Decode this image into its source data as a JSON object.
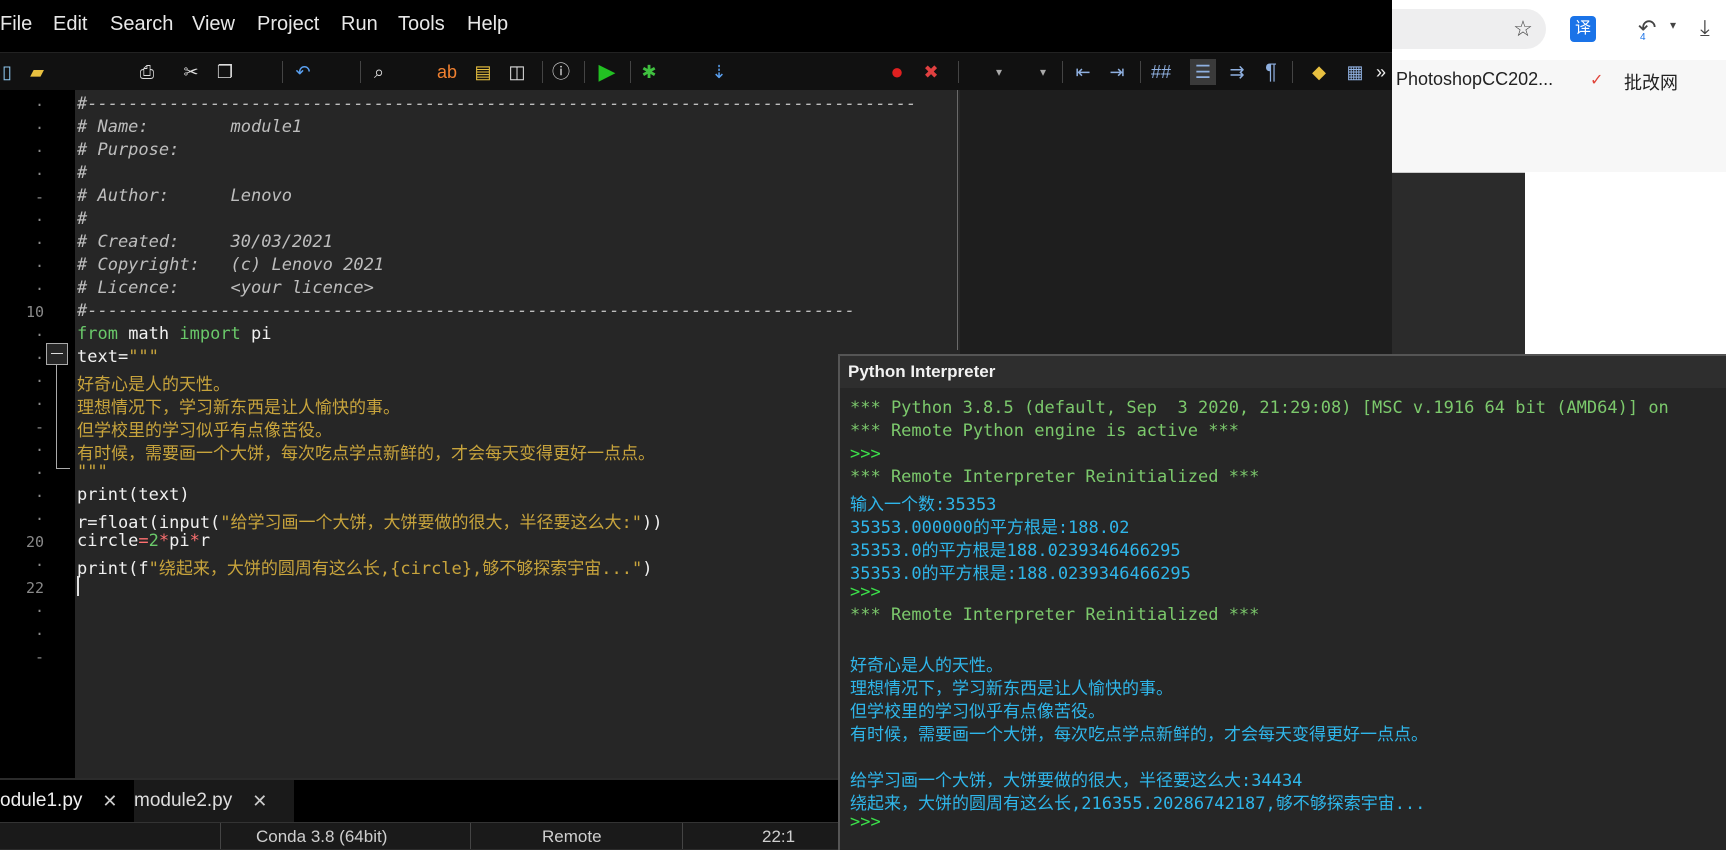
{
  "menu": [
    "File",
    "Edit",
    "Search",
    "View",
    "Project",
    "Run",
    "Tools",
    "Help"
  ],
  "toolbar_more": "»",
  "editor": {
    "lines": [
      {
        "n": "·",
        "t": "#---------------------------------------------------------------------------------"
      },
      {
        "n": "·",
        "t": "# Name:        module1"
      },
      {
        "n": "·",
        "t": "# Purpose:"
      },
      {
        "n": "·",
        "t": "#"
      },
      {
        "n": "-",
        "t": "# Author:      Lenovo"
      },
      {
        "n": "·",
        "t": "#"
      },
      {
        "n": "·",
        "t": "# Created:     30/03/2021"
      },
      {
        "n": "·",
        "t": "# Copyright:   (c) Lenovo 2021"
      },
      {
        "n": "·",
        "t": "# Licence:     <your licence>"
      },
      {
        "n": "10",
        "t": "#---------------------------------------------------------------------------"
      },
      {
        "n": "·",
        "t": "from math import pi"
      },
      {
        "n": "·",
        "t": "text=\"\"\""
      },
      {
        "n": "·",
        "t": "好奇心是人的天性。"
      },
      {
        "n": "·",
        "t": "理想情况下，学习新东西是让人愉快的事。"
      },
      {
        "n": "-",
        "t": "但学校里的学习似乎有点像苦役。"
      },
      {
        "n": "·",
        "t": "有时候，需要画一个大饼，每次吃点学点新鲜的，才会每天变得更好一点点。"
      },
      {
        "n": "·",
        "t": "\"\"\""
      },
      {
        "n": "·",
        "t": "print(text)"
      },
      {
        "n": "·",
        "t": "r=float(input(\"给学习画一个大饼，大饼要做的很大，半径要这么大:\"))"
      },
      {
        "n": "20",
        "t": "circle=2*pi*r"
      },
      {
        "n": "·",
        "t": "print(f\"绕起来，大饼的圆周有这么长,{circle},够不够探索宇宙...\")"
      },
      {
        "n": "22",
        "t": ""
      },
      {
        "n": "·",
        "t": ""
      },
      {
        "n": "·",
        "t": ""
      },
      {
        "n": "-",
        "t": ""
      }
    ]
  },
  "tabs": [
    {
      "label": "odule1.py",
      "close": "✕"
    },
    {
      "label": "module2.py",
      "close": "✕"
    }
  ],
  "status": {
    "interpreter": "Conda 3.8 (64bit)",
    "mode": "Remote",
    "position": "22:1"
  },
  "browser": {
    "translate_icon": "译",
    "badge": "4",
    "bookmark1": "PhotoshopCC202...",
    "bookmark2": "批改网"
  },
  "interpreter": {
    "title": "Python Interpreter",
    "lines": [
      {
        "c": "green",
        "t": "*** Python 3.8.5 (default, Sep  3 2020, 21:29:08) [MSC v.1916 64 bit (AMD64)] on"
      },
      {
        "c": "green",
        "t": "*** Remote Python engine is active ***"
      },
      {
        "c": "prompt",
        "t": ">>>"
      },
      {
        "c": "green",
        "t": "*** Remote Interpreter Reinitialized ***"
      },
      {
        "c": "cyan",
        "t": "输入一个数:35353"
      },
      {
        "c": "cyan",
        "t": "35353.000000的平方根是:188.02"
      },
      {
        "c": "cyan",
        "t": "35353.0的平方根是188.0239346466295"
      },
      {
        "c": "cyan",
        "t": "35353.0的平方根是:188.0239346466295"
      },
      {
        "c": "prompt",
        "t": ">>>"
      },
      {
        "c": "green",
        "t": "*** Remote Interpreter Reinitialized ***"
      },
      {
        "c": "cyan",
        "t": ""
      },
      {
        "c": "cyan",
        "t": "好奇心是人的天性。"
      },
      {
        "c": "cyan",
        "t": "理想情况下，学习新东西是让人愉快的事。"
      },
      {
        "c": "cyan",
        "t": "但学校里的学习似乎有点像苦役。"
      },
      {
        "c": "cyan",
        "t": "有时候，需要画一个大饼，每次吃点学点新鲜的，才会每天变得更好一点点。"
      },
      {
        "c": "cyan",
        "t": ""
      },
      {
        "c": "cyan",
        "t": "给学习画一个大饼，大饼要做的很大，半径要这么大:34434"
      },
      {
        "c": "cyan",
        "t": "绕起来，大饼的圆周有这么长,216355.20286742187,够不够探索宇宙..."
      },
      {
        "c": "prompt",
        "t": ">>>"
      }
    ]
  }
}
